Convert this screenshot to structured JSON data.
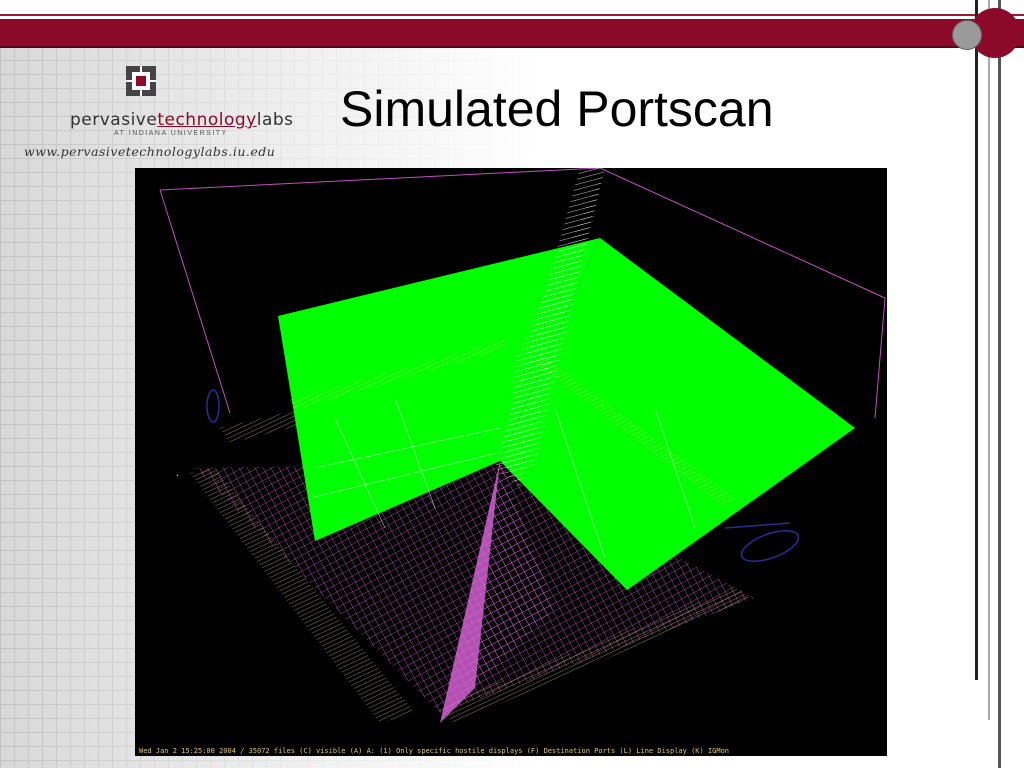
{
  "slide": {
    "title": "Simulated Portscan"
  },
  "logo": {
    "text_part1": "pervasive",
    "text_part2": "technology",
    "text_part3": "labs",
    "subtitle": "AT INDIANA UNIVERSITY",
    "url": "www.pervasivetechnologylabs.iu.edu"
  },
  "visualization": {
    "status_line": "Wed Jan 2 15:25:00 2004 / 35072 files (C) visible (A) A: (1) Only specific hostile displays (F) Destination Ports (L) Line Display (K) IGMon",
    "colors": {
      "background": "#000000",
      "plane": "#00ff00",
      "magenta": "#e060e0",
      "yellow": "#e8d878",
      "white": "#ffffff",
      "blue": "#2a2a9a"
    }
  },
  "theme": {
    "accent": "#8b0a2a"
  }
}
